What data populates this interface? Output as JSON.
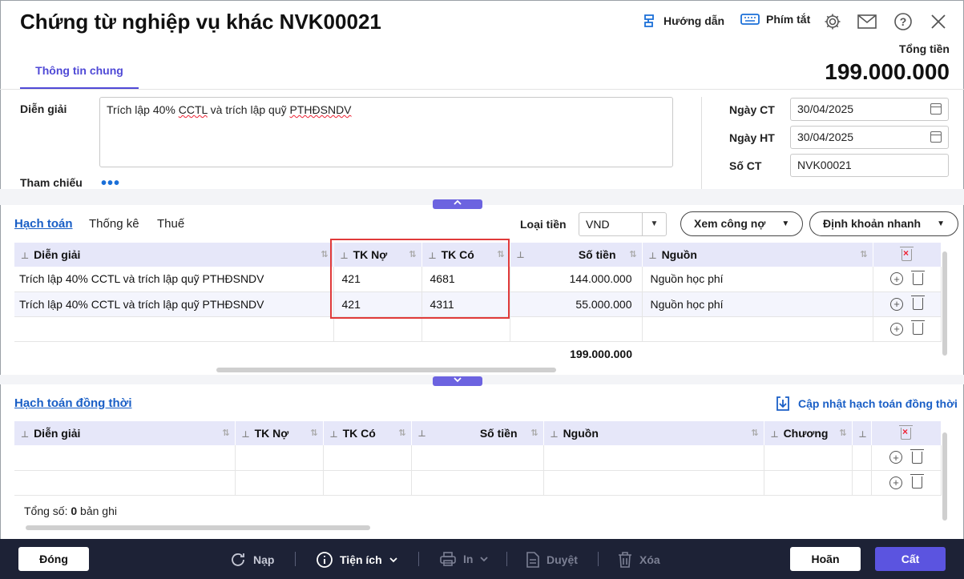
{
  "header": {
    "title": "Chứng từ nghiệp vụ khác NVK00021",
    "guide_label": "Hướng dẫn",
    "shortcut_label": "Phím tắt",
    "total_label": "Tổng tiền",
    "total_value": "199.000.000",
    "icons": [
      "settings-icon",
      "mail-icon",
      "help-icon",
      "close-icon"
    ]
  },
  "tabs": {
    "general": "Thông tin chung"
  },
  "general": {
    "description_label": "Diễn giải",
    "description_value_a": "Trích lập 40% ",
    "description_value_b": "CCTL",
    "description_value_c": " và trích lập quỹ ",
    "description_value_d": "PTHĐSNDV",
    "reference_label": "Tham chiếu",
    "reference_more": "•••",
    "date_ct_label": "Ngày CT",
    "date_ct_value": "30/04/2025",
    "date_ht_label": "Ngày HT",
    "date_ht_value": "30/04/2025",
    "doc_no_label": "Số CT",
    "doc_no_value": "NVK00021"
  },
  "detail": {
    "tabs": [
      "Hạch toán",
      "Thống kê",
      "Thuế"
    ],
    "currency_label": "Loại tiền",
    "currency_value": "VND",
    "debt_button": "Xem công nợ",
    "quick_button": "Định khoản nhanh",
    "columns": [
      "Diễn giải",
      "TK Nợ",
      "TK Có",
      "Số tiền",
      "Nguồn"
    ],
    "rows": [
      {
        "desc": "Trích lập 40% CCTL và trích lập quỹ PTHĐSNDV",
        "debit": "421",
        "credit": "4681",
        "amount": "144.000.000",
        "source": "Nguồn học phí"
      },
      {
        "desc": "Trích lập 40% CCTL và trích lập quỹ PTHĐSNDV",
        "debit": "421",
        "credit": "4311",
        "amount": "55.000.000",
        "source": "Nguồn học phí"
      }
    ],
    "sum_amount": "199.000.000"
  },
  "concurrent": {
    "title": "Hạch toán đồng thời",
    "update_link": "Cập nhật hạch toán đồng thời",
    "columns": [
      "Diễn giải",
      "TK Nợ",
      "TK Có",
      "Số tiền",
      "Nguồn",
      "Chương"
    ],
    "total_prefix": "Tổng số: ",
    "total_count": "0",
    "total_suffix": " bản ghi"
  },
  "footer": {
    "close": "Đóng",
    "reload": "Nạp",
    "utilities": "Tiện ích",
    "print": "In",
    "approve": "Duyệt",
    "delete": "Xóa",
    "cancel": "Hoãn",
    "save": "Cất"
  },
  "colors": {
    "accent": "#5b54e0",
    "footer_bg": "#1d2236",
    "highlight": "#e03a3a",
    "link": "#1a5fc6"
  }
}
